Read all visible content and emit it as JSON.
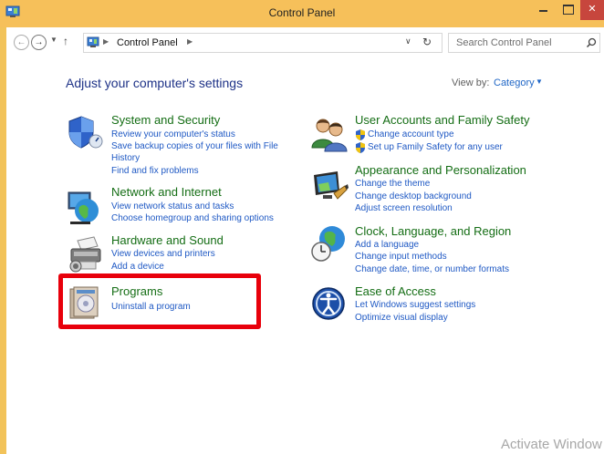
{
  "window": {
    "title": "Control Panel"
  },
  "address": {
    "location": "Control Panel"
  },
  "search": {
    "placeholder": "Search Control Panel"
  },
  "main": {
    "heading": "Adjust your computer's settings",
    "view_by_label": "View by:",
    "view_by_value": "Category"
  },
  "categories": [
    {
      "title": "System and Security",
      "links": [
        "Review your computer's status",
        "Save backup copies of your files with File",
        "History",
        "Find and fix problems"
      ],
      "icon": "shield-icon"
    },
    {
      "title": "Network and Internet",
      "links": [
        "View network status and tasks",
        "Choose homegroup and sharing options"
      ],
      "icon": "network-globe-icon"
    },
    {
      "title": "Hardware and Sound",
      "links": [
        "View devices and printers",
        "Add a device"
      ],
      "icon": "printer-icon"
    },
    {
      "title": "Programs",
      "links": [
        "Uninstall a program"
      ],
      "icon": "programs-icon"
    },
    {
      "title": "User Accounts and Family Safety",
      "links": [
        "Change account type",
        "Set up Family Safety for any user"
      ],
      "icon": "users-icon"
    },
    {
      "title": "Appearance and Personalization",
      "links": [
        "Change the theme",
        "Change desktop background",
        "Adjust screen resolution"
      ],
      "icon": "monitor-icon"
    },
    {
      "title": "Clock, Language, and Region",
      "links": [
        "Add a language",
        "Change input methods",
        "Change date, time, or number formats"
      ],
      "icon": "clock-globe-icon"
    },
    {
      "title": "Ease of Access",
      "links": [
        "Let Windows suggest settings",
        "Optimize visual display"
      ],
      "icon": "accessibility-icon"
    }
  ],
  "watermark": "Activate Window",
  "colors": {
    "titlebar": "#f6c05a",
    "close": "#c7463d",
    "category_title": "#146d14",
    "link": "#1f59c4",
    "highlight": "#e8000b"
  }
}
